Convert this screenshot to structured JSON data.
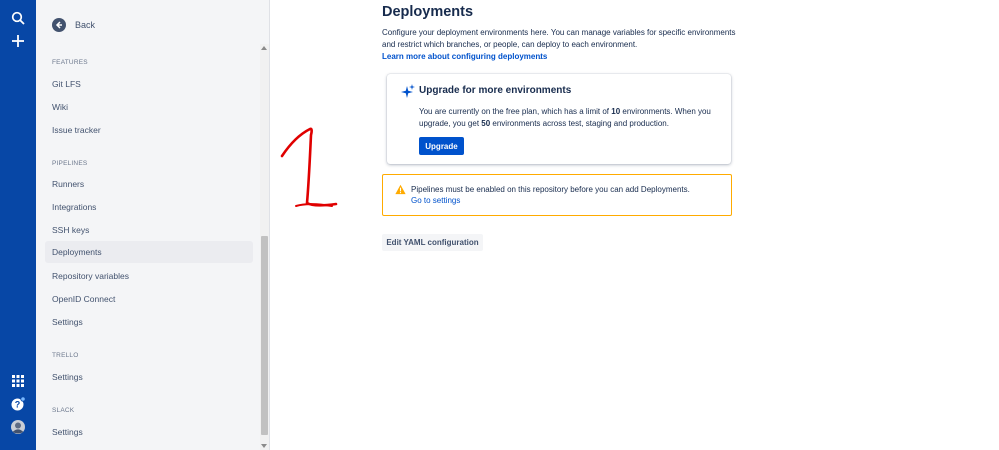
{
  "sidebar": {
    "back_label": "Back",
    "sections": [
      {
        "heading": "FEATURES",
        "items": [
          "Git LFS",
          "Wiki",
          "Issue tracker"
        ]
      },
      {
        "heading": "PIPELINES",
        "items": [
          "Runners",
          "Integrations",
          "SSH keys",
          "Deployments",
          "Repository variables",
          "OpenID Connect",
          "Settings"
        ]
      },
      {
        "heading": "TRELLO",
        "items": [
          "Settings"
        ]
      },
      {
        "heading": "SLACK",
        "items": [
          "Settings"
        ]
      }
    ],
    "active_item": "Deployments"
  },
  "main": {
    "title": "Deployments",
    "description": "Configure your deployment environments here. You can manage variables for specific environments and restrict which branches, or people, can deploy to each environment.",
    "learn_link": "Learn more about configuring deployments",
    "learn_suffix": ".",
    "upgrade": {
      "title": "Upgrade for more environments",
      "text_1": "You are currently on the free plan, which has a limit of ",
      "limit": "10",
      "text_2": " environments. When you upgrade, you get ",
      "upgrade_count": "50",
      "text_3": " environments across test, staging and production.",
      "button": "Upgrade"
    },
    "warning": {
      "text": "Pipelines must be enabled on this repository before you can add Deployments.",
      "link": "Go to settings"
    },
    "yaml_button": "Edit YAML configuration"
  },
  "colors": {
    "rail": "#0747a6",
    "primary": "#0052cc",
    "warning_border": "#ffab00",
    "annotation": "#e00000"
  },
  "icons": [
    "search-icon",
    "plus-icon",
    "app-switcher-icon",
    "help-icon",
    "avatar",
    "back-arrow-icon",
    "sparkle-icon",
    "warning-icon"
  ]
}
